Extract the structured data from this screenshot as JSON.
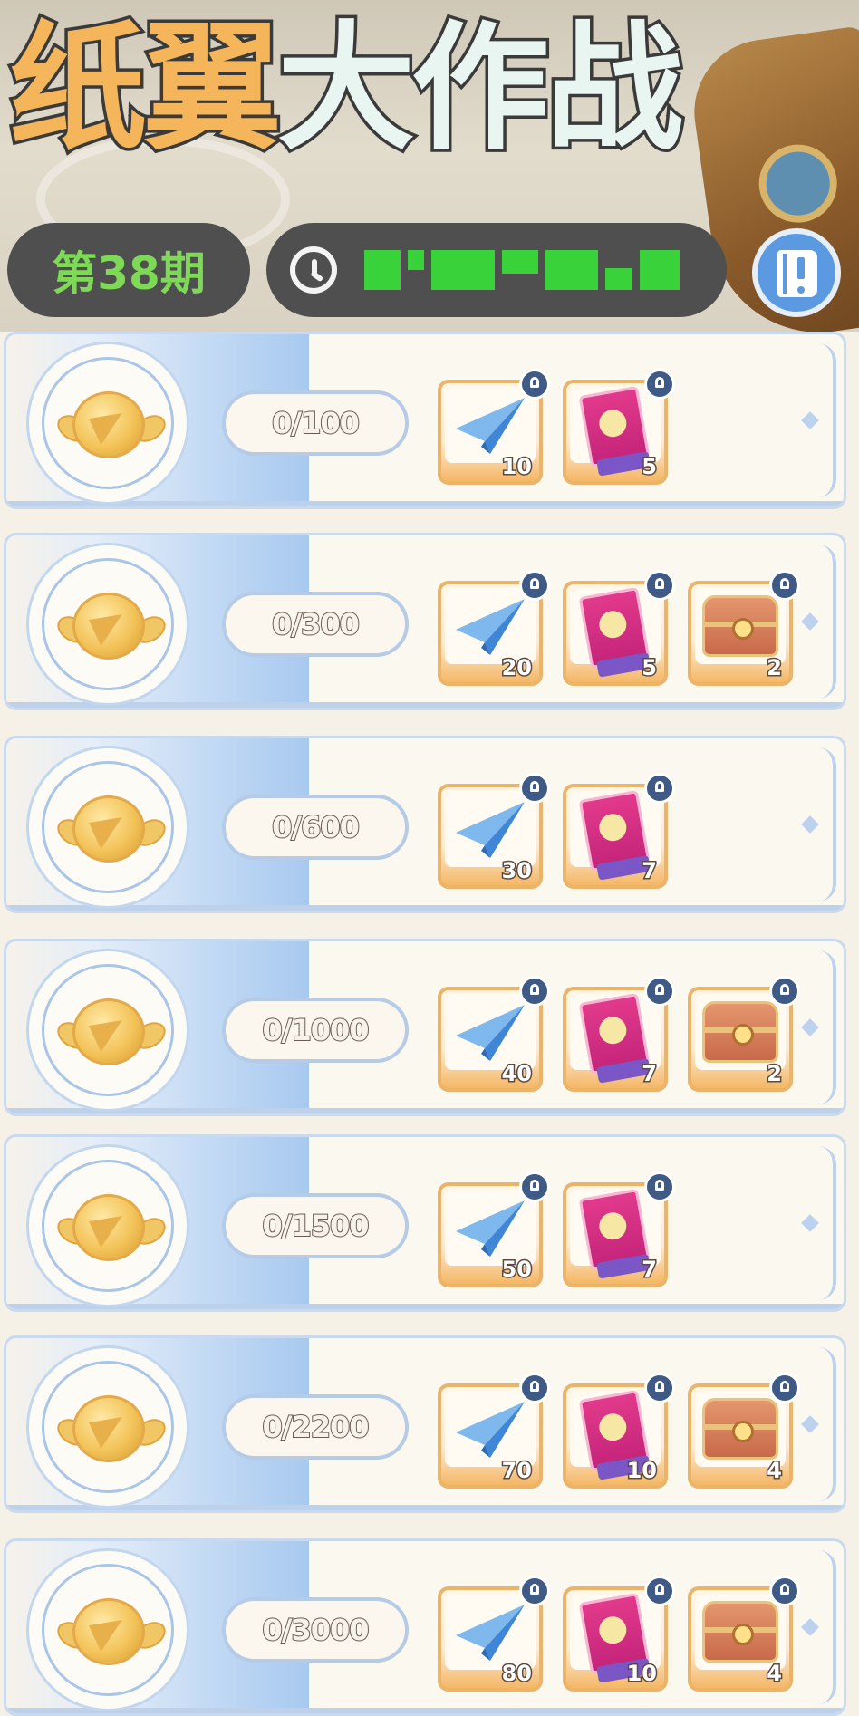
{
  "header": {
    "title_part1": "纸翼",
    "title_part2": "大作战",
    "issue_label": "第38期"
  },
  "rows": [
    {
      "progress": "0/100",
      "rewards": [
        {
          "item": "paper-plane",
          "qty": "10"
        },
        {
          "item": "pink-card",
          "qty": "5"
        }
      ]
    },
    {
      "progress": "0/300",
      "rewards": [
        {
          "item": "paper-plane",
          "qty": "20"
        },
        {
          "item": "pink-card",
          "qty": "5"
        },
        {
          "item": "treasure-chest",
          "qty": "2"
        }
      ]
    },
    {
      "progress": "0/600",
      "rewards": [
        {
          "item": "paper-plane",
          "qty": "30"
        },
        {
          "item": "pink-card",
          "qty": "7"
        }
      ]
    },
    {
      "progress": "0/1000",
      "rewards": [
        {
          "item": "paper-plane",
          "qty": "40"
        },
        {
          "item": "pink-card",
          "qty": "7"
        },
        {
          "item": "treasure-chest",
          "qty": "2"
        }
      ]
    },
    {
      "progress": "0/1500",
      "rewards": [
        {
          "item": "paper-plane",
          "qty": "50"
        },
        {
          "item": "pink-card",
          "qty": "7"
        }
      ]
    },
    {
      "progress": "0/2200",
      "rewards": [
        {
          "item": "paper-plane",
          "qty": "70"
        },
        {
          "item": "pink-card",
          "qty": "10"
        },
        {
          "item": "treasure-chest",
          "qty": "4"
        }
      ]
    },
    {
      "progress": "0/3000",
      "rewards": [
        {
          "item": "paper-plane",
          "qty": "80"
        },
        {
          "item": "pink-card",
          "qty": "10"
        },
        {
          "item": "treasure-chest",
          "qty": "4"
        }
      ]
    }
  ],
  "colors": {
    "title_orange": "#f5b55a",
    "title_mint": "#e9f5f0",
    "issue_green": "#7ed957",
    "pill_dark": "#4f4f4f",
    "accent_blue": "#5b9ae0",
    "row_border": "#c9d9ef"
  },
  "icons": {
    "timer": "clock-icon",
    "guide": "book-exclamation-icon",
    "lock": "lock-icon",
    "medal": "gold-wing-medal-icon"
  }
}
